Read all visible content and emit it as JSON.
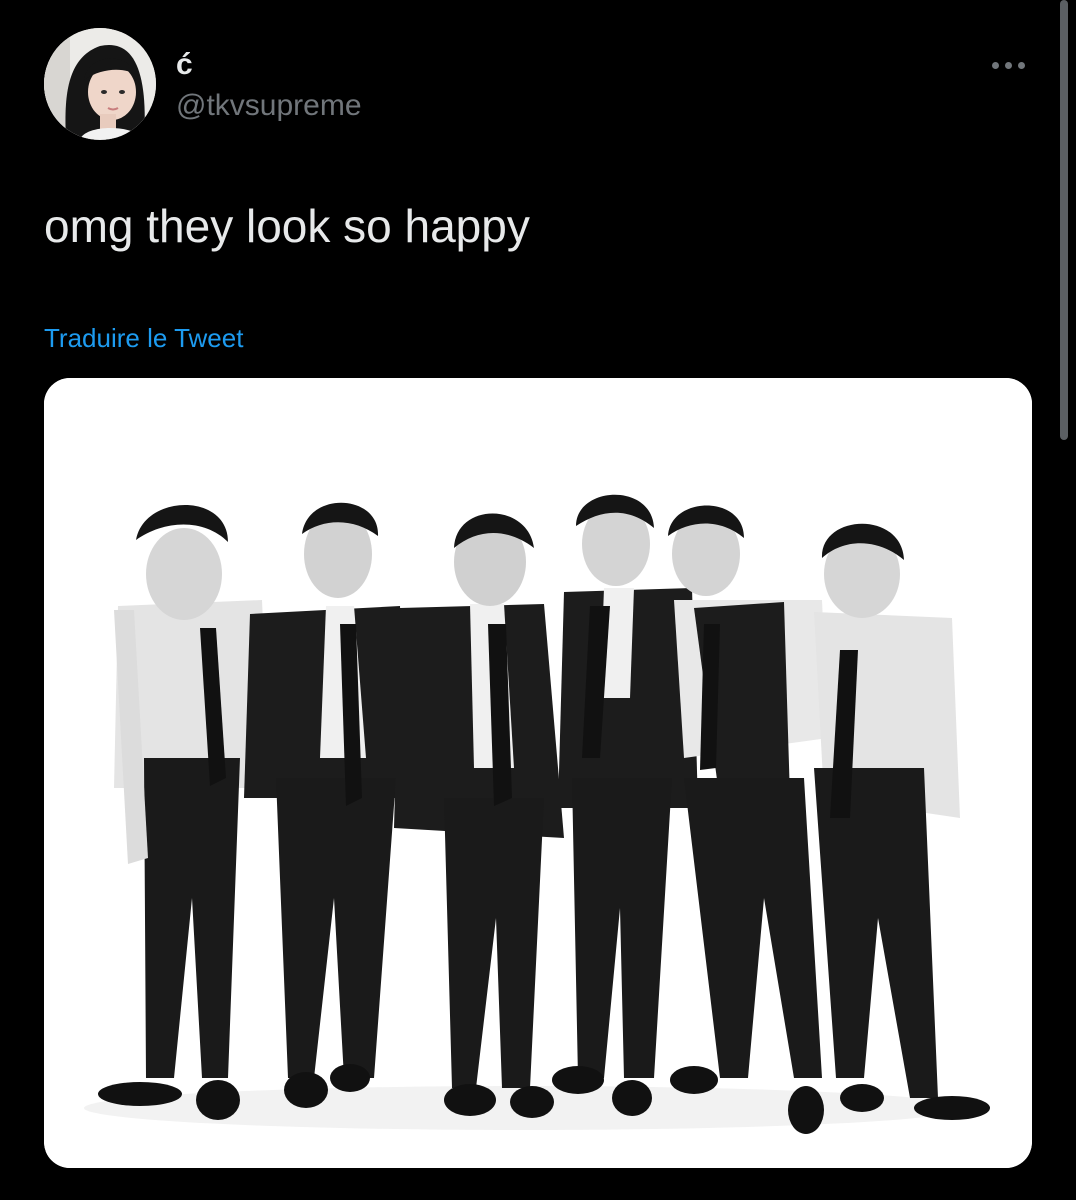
{
  "author": {
    "display_name": "ć",
    "handle": "@tkvsupreme"
  },
  "tweet": {
    "text": "omg they look so happy",
    "translate_label": "Traduire le Tweet"
  },
  "icons": {
    "more": "more-horizontal-icon"
  },
  "colors": {
    "background": "#000000",
    "primary_text": "#e7e9ea",
    "secondary_text": "#71767b",
    "link": "#1d9bf0",
    "media_background": "#ffffff"
  }
}
